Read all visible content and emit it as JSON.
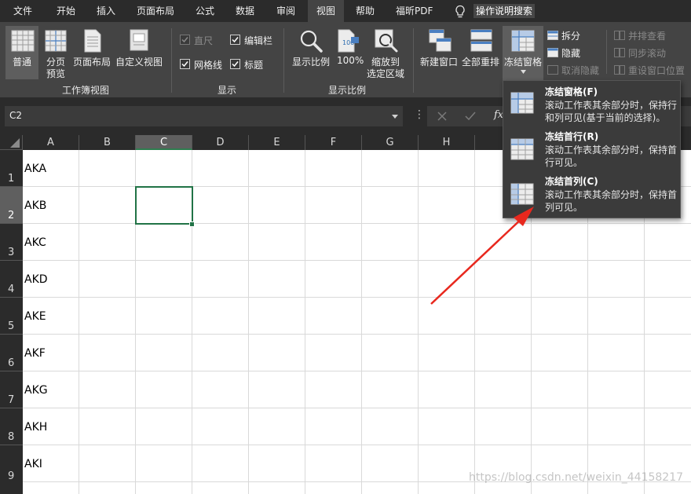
{
  "menu": {
    "items": [
      "文件",
      "开始",
      "插入",
      "页面布局",
      "公式",
      "数据",
      "审阅",
      "视图",
      "帮助",
      "福昕PDF"
    ],
    "active_index": 7,
    "search_label": "操作说明搜索"
  },
  "ribbon": {
    "views": {
      "normal": "普通",
      "page_break_1": "分页",
      "page_break_2": "预览",
      "page_layout": "页面布局",
      "custom_view": "自定义视图",
      "group_label": "工作簿视图"
    },
    "show": {
      "ruler": "直尺",
      "formula_bar": "编辑栏",
      "gridlines": "网格线",
      "headings": "标题",
      "group_label": "显示"
    },
    "zoom": {
      "zoom": "显示比例",
      "hundred": "100%",
      "zoom_sel_1": "缩放到",
      "zoom_sel_2": "选定区域",
      "group_label": "显示比例"
    },
    "window": {
      "new_window": "新建窗口",
      "arrange_all": "全部重排",
      "freeze_panes": "冻结窗格",
      "split": "拆分",
      "hide": "隐藏",
      "unhide": "取消隐藏",
      "side_by_side": "并排查看",
      "sync_scroll": "同步滚动",
      "reset_position": "重设窗口位置"
    }
  },
  "formula_bar": {
    "name_box": "C2",
    "fx": "fx"
  },
  "sheet": {
    "columns": [
      "A",
      "B",
      "C",
      "D",
      "E",
      "F",
      "G",
      "H"
    ],
    "rows": [
      "1",
      "2",
      "3",
      "4",
      "5",
      "6",
      "7",
      "8",
      "9"
    ],
    "column_a_values": [
      "AKA",
      "AKB",
      "AKC",
      "AKD",
      "AKE",
      "AKF",
      "AKG",
      "AKH",
      "AKI"
    ],
    "selected_cell": "C2"
  },
  "freeze_menu": {
    "items": [
      {
        "title": "冻结窗格(F)",
        "desc": "滚动工作表其余部分时，保持行和列可见(基于当前的选择)。"
      },
      {
        "title": "冻结首行(R)",
        "desc": "滚动工作表其余部分时，保持首行可见。"
      },
      {
        "title": "冻结首列(C)",
        "desc": "滚动工作表其余部分时，保持首列可见。"
      }
    ]
  },
  "watermark": "https://blog.csdn.net/weixin_44158217",
  "colors": {
    "menubar_bg": "#2b2b2b",
    "ribbon_bg": "#444444",
    "selection_green": "#217346",
    "annotation_red": "#e8281e"
  }
}
